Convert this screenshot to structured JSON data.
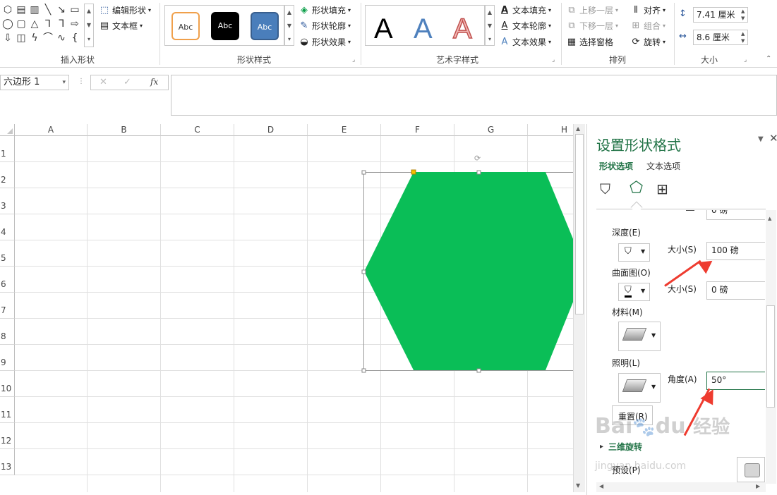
{
  "ribbon": {
    "insert_shapes": {
      "label": "插入形状",
      "edit_shape": "编辑形状",
      "text_box": "文本框"
    },
    "shape_styles": {
      "label": "形状样式",
      "presets": [
        "Abc",
        "Abc",
        "Abc"
      ],
      "fill": "形状填充",
      "outline": "形状轮廓",
      "effects": "形状效果"
    },
    "wordart_styles": {
      "label": "艺术字样式",
      "letters": [
        "A",
        "A",
        "A"
      ],
      "text_fill": "文本填充",
      "text_outline": "文本轮廓",
      "text_effects": "文本效果"
    },
    "arrange": {
      "label": "排列",
      "bring_forward": "上移一层",
      "send_backward": "下移一层",
      "selection_pane": "选择窗格",
      "align": "对齐",
      "group": "组合",
      "rotate": "旋转"
    },
    "size": {
      "label": "大小",
      "height": "7.41 厘米",
      "width": "8.6 厘米"
    }
  },
  "formula_bar": {
    "name_box": "六边形 1",
    "fx": "fx",
    "cancel": "✕",
    "enter": "✓",
    "value": ""
  },
  "sheet": {
    "columns": [
      "A",
      "B",
      "C",
      "D",
      "E",
      "F",
      "G",
      "H"
    ],
    "rows": [
      "1",
      "2",
      "3",
      "4",
      "5",
      "6",
      "7",
      "8",
      "9",
      "10",
      "11",
      "12",
      "13"
    ],
    "shape_color": "#0abe57"
  },
  "panel": {
    "title": "设置形状格式",
    "tabs": [
      "形状选项",
      "文本选项"
    ],
    "top_cut_value": "0 磅",
    "depth_label": "深度(E)",
    "depth_size_label": "大小(S)",
    "depth_size_value": "100 磅",
    "contour_label": "曲面图(O)",
    "contour_size_label": "大小(S)",
    "contour_size_value": "0 磅",
    "material_label": "材料(M)",
    "lighting_label": "照明(L)",
    "angle_label": "角度(A)",
    "angle_value": "50°",
    "reset_label": "重置(R)",
    "rotation_section": "三维旋转",
    "preset_label": "预设(P)"
  },
  "watermark": {
    "text1": "Bai",
    "text2": "du",
    "text3": "经验",
    "text4": "jingyan.baidu.com"
  },
  "colors": {
    "accent_green": "#217346",
    "annotation_red": "#ee3b2f"
  }
}
